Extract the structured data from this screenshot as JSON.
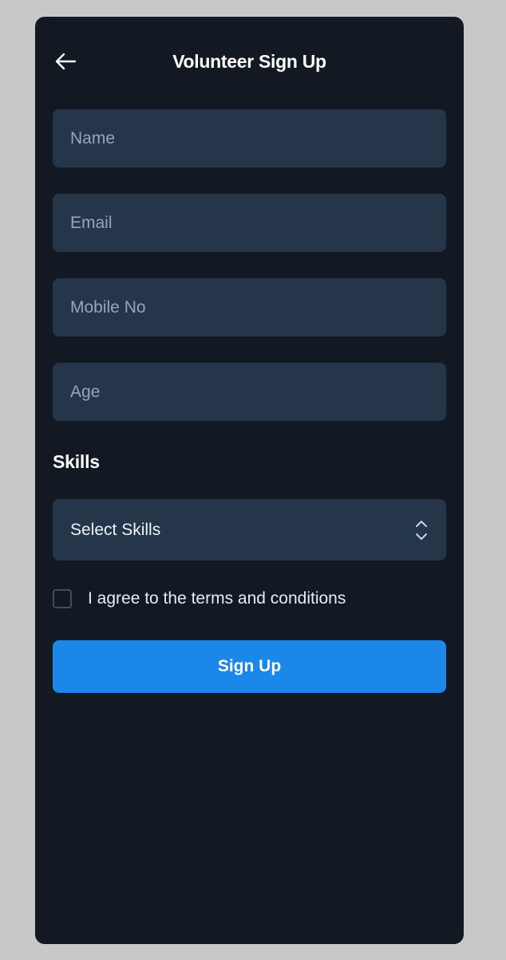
{
  "header": {
    "title": "Volunteer Sign Up",
    "back_icon": "arrow-left-icon"
  },
  "form": {
    "name_placeholder": "Name",
    "email_placeholder": "Email",
    "mobile_placeholder": "Mobile No",
    "age_placeholder": "Age",
    "skills_label": "Skills",
    "skills_select_value": "Select Skills",
    "skills_select_icon": "chevron-up-down-icon",
    "terms_label": "I agree to the terms and conditions",
    "terms_checked": false,
    "submit_label": "Sign Up"
  },
  "colors": {
    "background": "#c8c8c8",
    "panel": "#121923",
    "field": "#25364b",
    "placeholder": "#93a6bd",
    "primary": "#1b87e8"
  }
}
